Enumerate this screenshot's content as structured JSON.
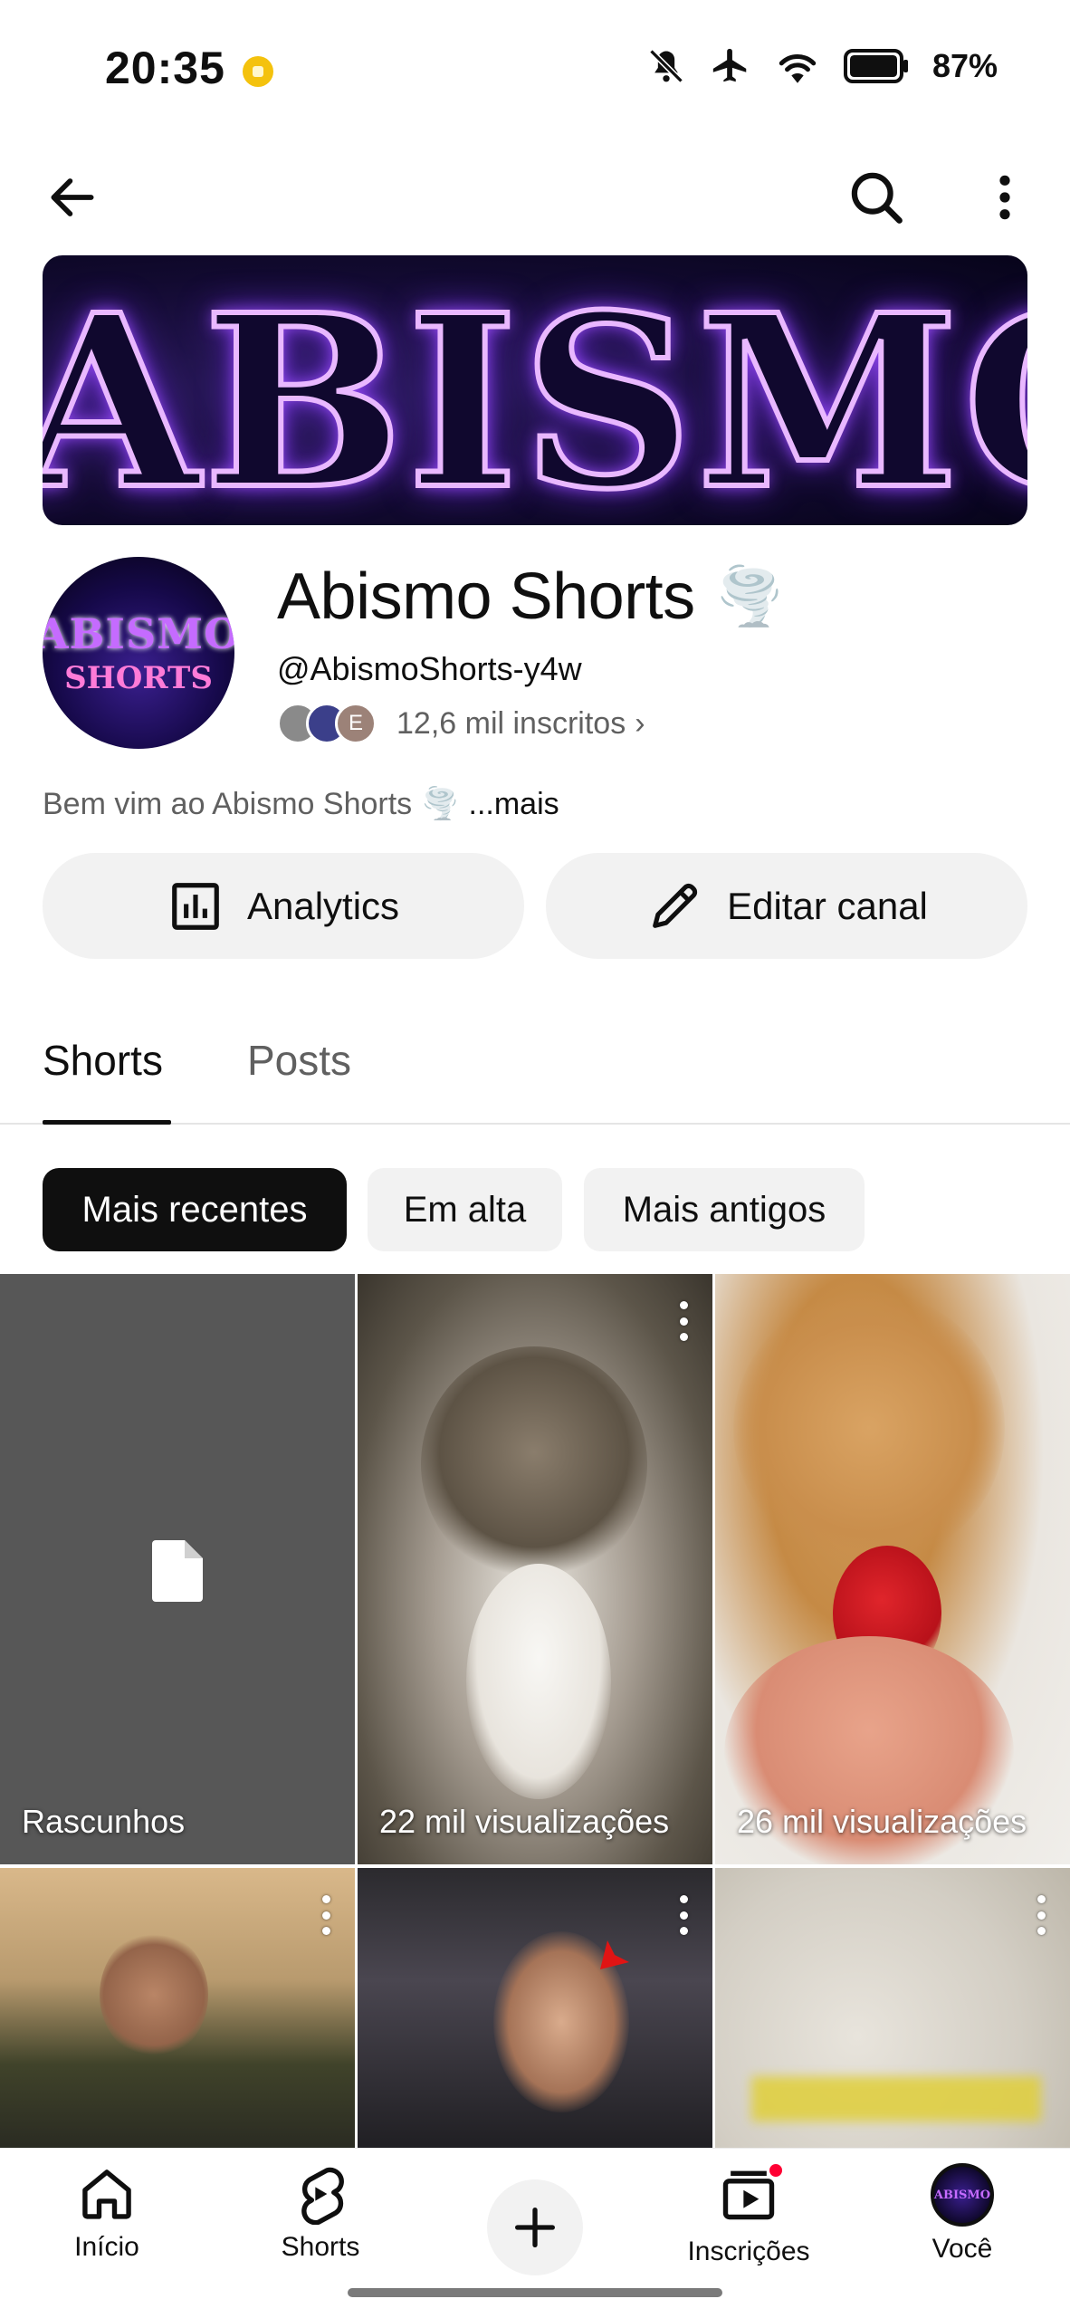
{
  "status_bar": {
    "time": "20:35",
    "battery": "87%"
  },
  "top_bar": {
    "back_icon": "arrow-left-icon",
    "search_icon": "search-icon",
    "more_icon": "more-vertical-icon"
  },
  "banner": {
    "text": "ABISMO"
  },
  "channel": {
    "avatar_line1": "ABISMO",
    "avatar_line2": "SHORTS",
    "name": "Abismo Shorts",
    "name_emoji": "🌪️",
    "handle": "@AbismoShorts-y4w",
    "subscriber_initial": "E",
    "subscribers": "12,6 mil inscritos",
    "subscribers_chevron": "›",
    "description": "Bem vim ao Abismo Shorts",
    "description_emoji": "🌪️",
    "description_more": "...mais"
  },
  "actions": {
    "analytics_label": "Analytics",
    "edit_label": "Editar canal"
  },
  "tabs": [
    {
      "label": "Shorts",
      "active": true
    },
    {
      "label": "Posts",
      "active": false
    }
  ],
  "chips": [
    {
      "label": "Mais recentes",
      "selected": true
    },
    {
      "label": "Em alta",
      "selected": false
    },
    {
      "label": "Mais antigos",
      "selected": false
    }
  ],
  "grid": {
    "drafts_label": "Rascunhos",
    "items": [
      {
        "views": "22 mil visualizações"
      },
      {
        "views": "26 mil visualizações"
      }
    ]
  },
  "bottom_nav": [
    {
      "label": "Início",
      "icon": "home-icon"
    },
    {
      "label": "Shorts",
      "icon": "shorts-icon"
    },
    {
      "label": "",
      "icon": "plus-icon"
    },
    {
      "label": "Inscrições",
      "icon": "subscriptions-icon"
    },
    {
      "label": "Você",
      "icon": "avatar-icon"
    }
  ],
  "colors": {
    "text_primary": "#0f0f0f",
    "text_secondary": "#606060",
    "chip_bg": "#f2f2f2",
    "notification": "#ff0033"
  }
}
